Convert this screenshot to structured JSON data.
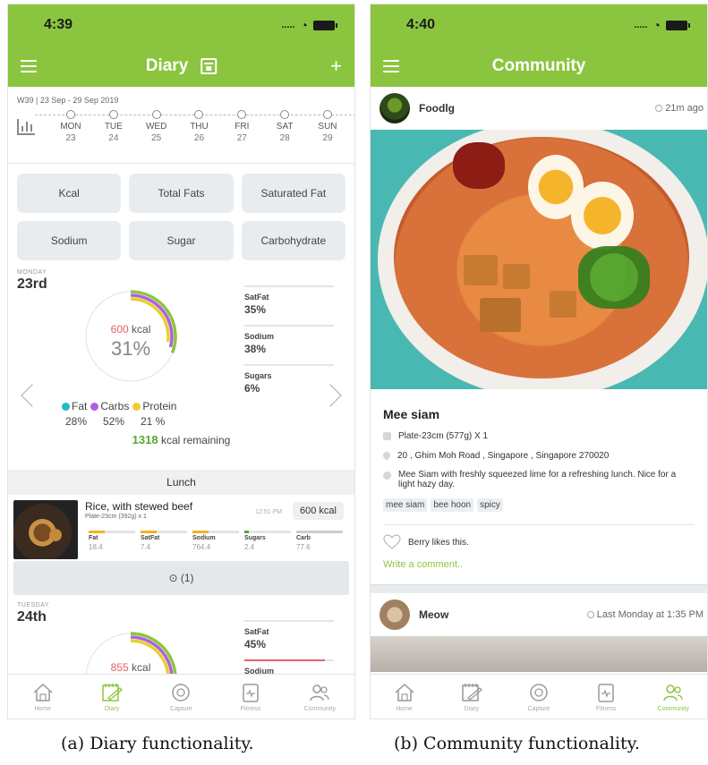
{
  "diary": {
    "status_time": "4:39",
    "title": "Diary",
    "week_label": "W39 | 23 Sep - 29 Sep 2019",
    "days": [
      {
        "name": "MON",
        "date": "23"
      },
      {
        "name": "TUE",
        "date": "24"
      },
      {
        "name": "WED",
        "date": "25"
      },
      {
        "name": "THU",
        "date": "26"
      },
      {
        "name": "FRI",
        "date": "27"
      },
      {
        "name": "SAT",
        "date": "28"
      },
      {
        "name": "SUN",
        "date": "29"
      }
    ],
    "chips": [
      "Kcal",
      "Total Fats",
      "Saturated Fat",
      "Sodium",
      "Sugar",
      "Carbohydrate"
    ],
    "day1": {
      "weekday": "MONDAY",
      "date": "23rd",
      "kcal_value": "600",
      "kcal_unit": "kcal",
      "percent": "31%",
      "percent_value": 31,
      "bars": [
        {
          "name": "SatFat",
          "pct": "35%",
          "fill": 0.35,
          "color": "#e5e5e5"
        },
        {
          "name": "Sodium",
          "pct": "38%",
          "fill": 0.38,
          "color": "#e5e5e5"
        },
        {
          "name": "Sugars",
          "pct": "6%",
          "fill": 0.06,
          "color": "#e5e5e5"
        }
      ],
      "legend": [
        {
          "label": "Fat",
          "pct": "28%",
          "color": "#27b9c9"
        },
        {
          "label": "Carbs",
          "pct": "52%",
          "color": "#b05ee0"
        },
        {
          "label": "Protein",
          "pct": "21 %",
          "color": "#e8cf2c"
        }
      ],
      "remaining_value": "1318",
      "remaining_text": "kcal remaining"
    },
    "meal": {
      "header": "Lunch",
      "name": "Rice, with stewed beef",
      "sub": "Plate-23cm (392g) x 1",
      "time": "12:51 PM",
      "kcal": "600 kcal",
      "nutrients": [
        {
          "name": "Fat",
          "value": "18.4",
          "fill": 0.35,
          "color": "#f0b324"
        },
        {
          "name": "SatFat",
          "value": "7.4",
          "fill": 0.35,
          "color": "#f0b324"
        },
        {
          "name": "Sodium",
          "value": "764.4",
          "fill": 0.35,
          "color": "#f0b324"
        },
        {
          "name": "Sugars",
          "value": "2.4",
          "fill": 0.1,
          "color": "#5aa832"
        },
        {
          "name": "Carb",
          "value": "77.6",
          "fill": 1.0,
          "color": "#cccccc"
        }
      ],
      "expand_label": "(1)"
    },
    "day2": {
      "weekday": "TUESDAY",
      "date": "24th",
      "kcal_value": "855",
      "kcal_unit": "kcal",
      "bars": [
        {
          "name": "SatFat",
          "pct": "45%",
          "fill": 0.45,
          "color": "#e5e5e5"
        },
        {
          "name": "Sodium",
          "pct": "",
          "fill": 0.9,
          "color": "#e8606b"
        }
      ]
    },
    "tabs": [
      {
        "label": "Home",
        "icon": "home-icon",
        "active": false
      },
      {
        "label": "Diary",
        "icon": "diary-icon",
        "active": true
      },
      {
        "label": "Capture",
        "icon": "capture-icon",
        "active": false
      },
      {
        "label": "Fitness",
        "icon": "fitness-icon",
        "active": false
      },
      {
        "label": "Community",
        "icon": "community-icon",
        "active": false
      }
    ]
  },
  "community": {
    "status_time": "4:40",
    "title": "Community",
    "post1": {
      "user": "Foodlg",
      "time": "21m ago",
      "title": "Mee siam",
      "portion": "Plate-23cm (577g) X 1",
      "location": "20 , Ghim Moh Road , Singapore , Singapore 270020",
      "description": "Mee Siam with freshly squeezed lime for a refreshing lunch. Nice for a light hazy day.",
      "tags": [
        "mee siam",
        "bee hoon",
        "spicy"
      ],
      "likes": "Berry likes this.",
      "comment_prompt": "Write a comment.."
    },
    "post2": {
      "user": "Meow",
      "time": "Last Monday at 1:35 PM"
    },
    "tabs": [
      {
        "label": "Home",
        "icon": "home-icon",
        "active": false
      },
      {
        "label": "Diary",
        "icon": "diary-icon",
        "active": false
      },
      {
        "label": "Capture",
        "icon": "capture-icon",
        "active": false
      },
      {
        "label": "Fitness",
        "icon": "fitness-icon",
        "active": false
      },
      {
        "label": "Community",
        "icon": "community-icon",
        "active": true
      }
    ]
  },
  "captions": {
    "a": "(a) Diary functionality.",
    "b": "(b) Community functionality."
  },
  "colors": {
    "brand": "#8bc53f",
    "kcal": "#e8606b",
    "remaining": "#5aa832"
  }
}
